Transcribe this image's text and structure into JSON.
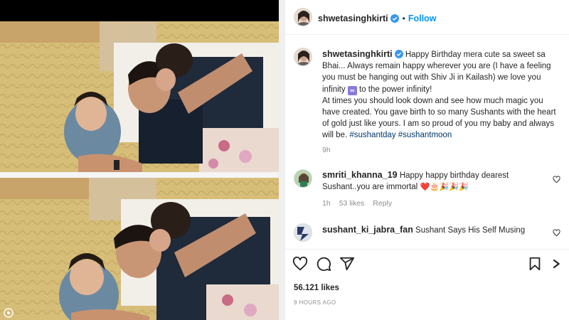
{
  "post_header": {
    "username": "shwetasinghkirti",
    "separator": "•",
    "follow_label": "Follow"
  },
  "caption": {
    "username": "shwetasinghkirti",
    "part1": "Happy Birthday mera cute sa sweet sa Bhai... Always remain happy wherever you are (I have a feeling you must be hanging out with Shiv Ji in Kailash) we love you infinity",
    "infinity_symbol": "∞",
    "part2": "to the power infinity!",
    "part3": "At times you should look down and see how much magic you have created. You gave birth to so many Sushants with the heart of gold just like yours. I am so proud of you my baby and always will be.",
    "hashtags": "#sushantday #sushantmoon",
    "time": "9h"
  },
  "comments": [
    {
      "username": "smriti_khanna_19",
      "text": "Happy happy birthday dearest Sushant..you are immortal",
      "emojis": "❤️🎂🎉🎉🎉",
      "time": "1h",
      "likes": "53 likes",
      "reply_label": "Reply"
    },
    {
      "username": "sushant_ki_jabra_fan",
      "text": "Sushant Says His Self Musing"
    }
  ],
  "likes_count": "56.121 likes",
  "posted_ago": "9 HOURS AGO",
  "icons": {
    "verified": "verified-badge-icon",
    "heart": "heart-icon",
    "comment": "comment-icon",
    "share": "share-icon",
    "save": "bookmark-icon",
    "more": "more-icon"
  },
  "colors": {
    "follow": "#0095f6",
    "verified": "#3897f0",
    "heart_red": "#ed4956"
  }
}
